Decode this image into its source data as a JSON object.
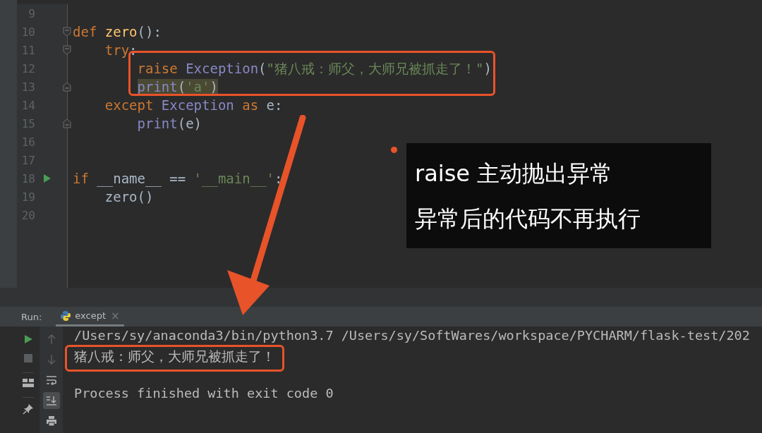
{
  "editor": {
    "lines": [
      {
        "number": "9",
        "fold_start": false,
        "fold_end": false,
        "run": false
      },
      {
        "number": "10",
        "fold_start": true,
        "fold_end": false,
        "run": false,
        "highlighted": false,
        "tokens": [
          {
            "text": "def ",
            "kind": "keyword"
          },
          {
            "text": "zero",
            "kind": "function"
          },
          {
            "text": "():",
            "kind": "plain"
          }
        ]
      },
      {
        "number": "11",
        "fold_start": true,
        "fold_end": false,
        "run": false,
        "highlighted": false,
        "tokens": [
          {
            "text": "    try",
            "kind": "keyword"
          },
          {
            "text": ":",
            "kind": "plain"
          }
        ]
      },
      {
        "number": "12",
        "fold_start": false,
        "fold_end": false,
        "run": false,
        "highlighted": false,
        "tokens": [
          {
            "text": "        raise ",
            "kind": "keyword"
          },
          {
            "text": "Exception",
            "kind": "builtin"
          },
          {
            "text": "(",
            "kind": "plain"
          },
          {
            "text": "\"猪八戒：师父，大师兄被抓走了！\"",
            "kind": "string"
          },
          {
            "text": ")",
            "kind": "plain"
          }
        ]
      },
      {
        "number": "13",
        "fold_start": false,
        "fold_end": true,
        "run": false,
        "highlighted": true,
        "tokens": [
          {
            "text": "        print",
            "kind": "builtin"
          },
          {
            "text": "(",
            "kind": "plain"
          },
          {
            "text": "'a'",
            "kind": "string"
          },
          {
            "text": ")",
            "kind": "plain"
          }
        ]
      },
      {
        "number": "14",
        "fold_start": false,
        "fold_end": false,
        "run": false,
        "highlighted": false,
        "tokens": [
          {
            "text": "    except ",
            "kind": "keyword"
          },
          {
            "text": "Exception ",
            "kind": "builtin"
          },
          {
            "text": "as ",
            "kind": "keyword"
          },
          {
            "text": "e:",
            "kind": "plain"
          }
        ]
      },
      {
        "number": "15",
        "fold_start": false,
        "fold_end": true,
        "run": false,
        "highlighted": false,
        "tokens": [
          {
            "text": "        print",
            "kind": "builtin"
          },
          {
            "text": "(e)",
            "kind": "plain"
          }
        ]
      },
      {
        "number": "16",
        "fold_start": false,
        "fold_end": false,
        "run": false
      },
      {
        "number": "17",
        "fold_start": false,
        "fold_end": false,
        "run": false
      },
      {
        "number": "18",
        "fold_start": false,
        "fold_end": false,
        "run": true,
        "highlighted": false,
        "tokens": [
          {
            "text": "if ",
            "kind": "keyword"
          },
          {
            "text": "__name__ == ",
            "kind": "plain"
          },
          {
            "text": "'__main__'",
            "kind": "string"
          },
          {
            "text": ":",
            "kind": "plain"
          }
        ]
      },
      {
        "number": "19",
        "fold_start": false,
        "fold_end": false,
        "run": false,
        "highlighted": false,
        "tokens": [
          {
            "text": "    zero()",
            "kind": "plain"
          }
        ]
      },
      {
        "number": "20",
        "fold_start": false,
        "fold_end": false,
        "run": false
      }
    ]
  },
  "callout": {
    "lines": [
      "raise 主动抛出异常",
      "异常后的代码不再执行"
    ]
  },
  "run_panel": {
    "label": "Run:",
    "tabs": [
      {
        "label": "except",
        "close": "×",
        "selected": true
      }
    ],
    "toolbar_left": [
      {
        "kind": "run"
      },
      {
        "kind": "stop"
      },
      {
        "kind": "layout"
      },
      {
        "kind": "pin"
      }
    ],
    "toolbar_right": [
      {
        "kind": "up",
        "selected": false
      },
      {
        "kind": "down",
        "selected": false
      },
      {
        "kind": "wrap",
        "selected": false
      },
      {
        "kind": "scroll-end",
        "selected": true
      },
      {
        "kind": "print",
        "selected": false
      }
    ],
    "console": [
      {
        "kind": "command",
        "text": "/Users/sy/anaconda3/bin/python3.7 /Users/sy/SoftWares/workspace/PYCHARM/flask-test/202"
      },
      {
        "kind": "output",
        "text": "猪八戒：师父，大师兄被抓走了！"
      },
      {
        "kind": "status",
        "text": "Process finished with exit code 0"
      }
    ]
  }
}
